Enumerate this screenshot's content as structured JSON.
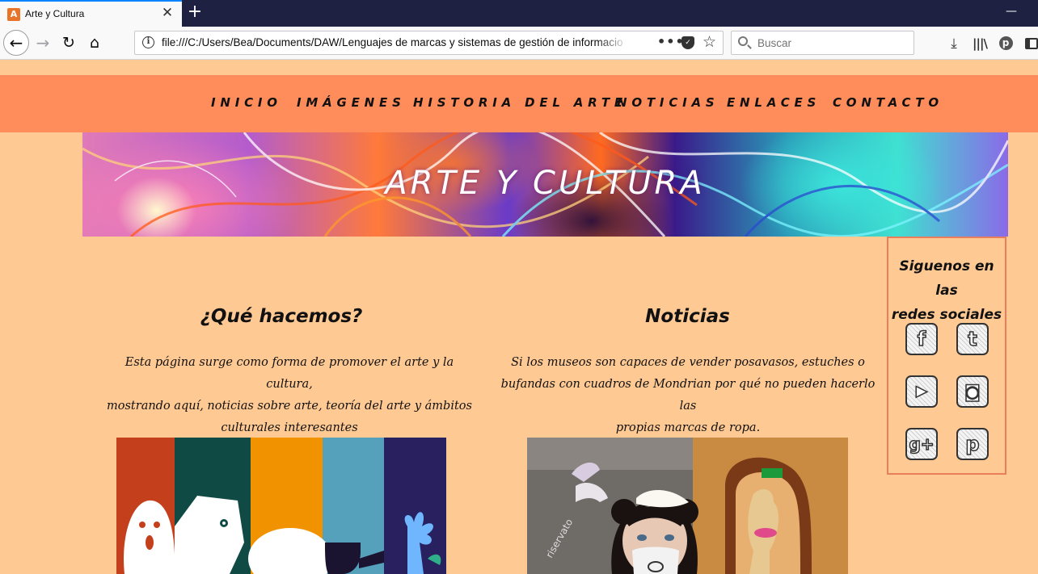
{
  "browser": {
    "tab_title": "Arte y Cultura",
    "tab_favicon": "A",
    "url": "file:///C:/Users/Bea/Documents/DAW/Lenguajes de marcas y sistemas de gestión de informacio",
    "search_placeholder": "Buscar",
    "icons": [
      "back-icon",
      "forward-icon",
      "reload-icon",
      "home-icon",
      "info-icon",
      "page-actions-icon",
      "pocket-icon",
      "bookmark-star-icon",
      "search-icon",
      "download-icon",
      "library-icon",
      "pinterest-icon",
      "sidebar-icon"
    ]
  },
  "site_nav": {
    "items": [
      "INICIO",
      "IMÁGENES",
      "HISTORIA DEL ARTE",
      "NOTICIAS",
      "ENLACES",
      "CONTACTO"
    ]
  },
  "hero": {
    "title": "ARTE Y CULTURA"
  },
  "columns": {
    "left": {
      "heading": "¿Qué hacemos?",
      "lines": [
        "Esta página surge como forma de promover el arte y la cultura,",
        "mostrando aquí, noticias sobre arte, teoría del arte y ámbitos",
        "culturales interesantes"
      ]
    },
    "right": {
      "heading": "Noticias",
      "lines": [
        "Si los museos son capaces de vender posavasos, estuches o",
        "bufandas con cuadros de Mondrian por qué no pueden hacerlo las",
        "propias marcas de ropa."
      ]
    }
  },
  "social": {
    "title_line1": "Siguenos en las",
    "title_line2": "redes sociales",
    "icons": [
      {
        "name": "facebook-icon",
        "glyph": "f"
      },
      {
        "name": "tumblr-icon",
        "glyph": "t"
      },
      {
        "name": "youtube-icon",
        "glyph": "▶"
      },
      {
        "name": "instagram-icon",
        "glyph": "◙"
      },
      {
        "name": "google-plus-icon",
        "glyph": "g+"
      },
      {
        "name": "pinterest-social-icon",
        "glyph": "p"
      }
    ]
  },
  "colors": {
    "page_bg": "#ffc993",
    "nav_bg": "#ff8c5b",
    "social_border": "#e87e5e",
    "tabbar_bg": "#1f2143"
  }
}
